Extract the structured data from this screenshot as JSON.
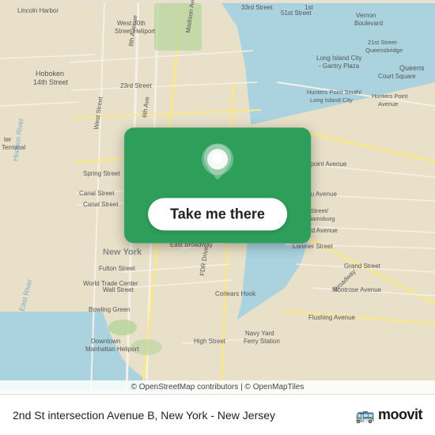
{
  "map": {
    "attribution": "© OpenStreetMap contributors | © OpenMapTiles"
  },
  "button": {
    "label": "Take me there"
  },
  "bottom_bar": {
    "location_text": "2nd St intersection Avenue B, New York - New Jersey",
    "moovit_label": "moovit",
    "moovit_emoji": "🚌"
  }
}
